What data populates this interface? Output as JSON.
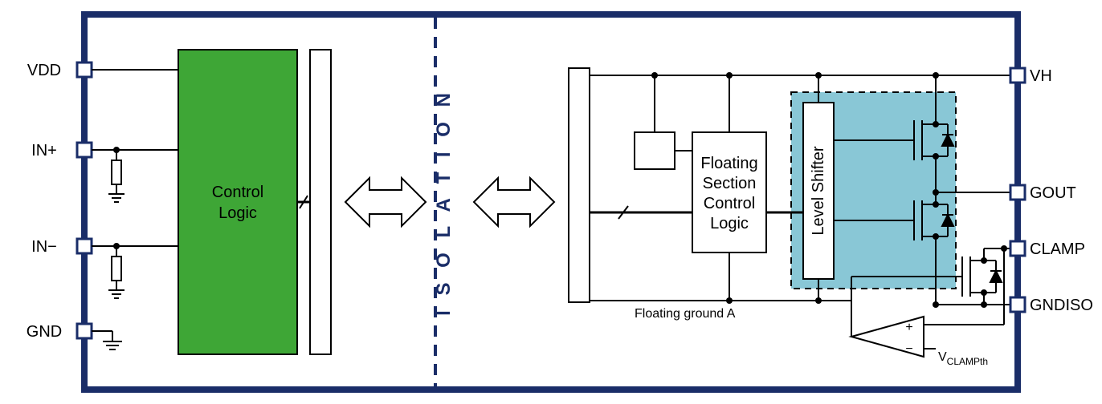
{
  "pins_left": {
    "vdd": "VDD",
    "in_plus": "IN+",
    "in_minus": "IN−",
    "gnd": "GND"
  },
  "pins_right": {
    "vh": "VH",
    "gout": "GOUT",
    "clamp": "CLAMP",
    "gndiso": "GNDISO"
  },
  "blocks": {
    "control_logic_l1": "Control",
    "control_logic_l2": "Logic",
    "float_section_l1": "Floating",
    "float_section_l2": "Section",
    "float_section_l3": "Control",
    "float_section_l4": "Logic",
    "level_shifter": "Level Shifter"
  },
  "labels": {
    "isolation": "I S O L A T I O N",
    "floating_ground": "Floating ground A",
    "vclamp_prefix": "V",
    "vclamp_sub": "CLAMPth"
  }
}
